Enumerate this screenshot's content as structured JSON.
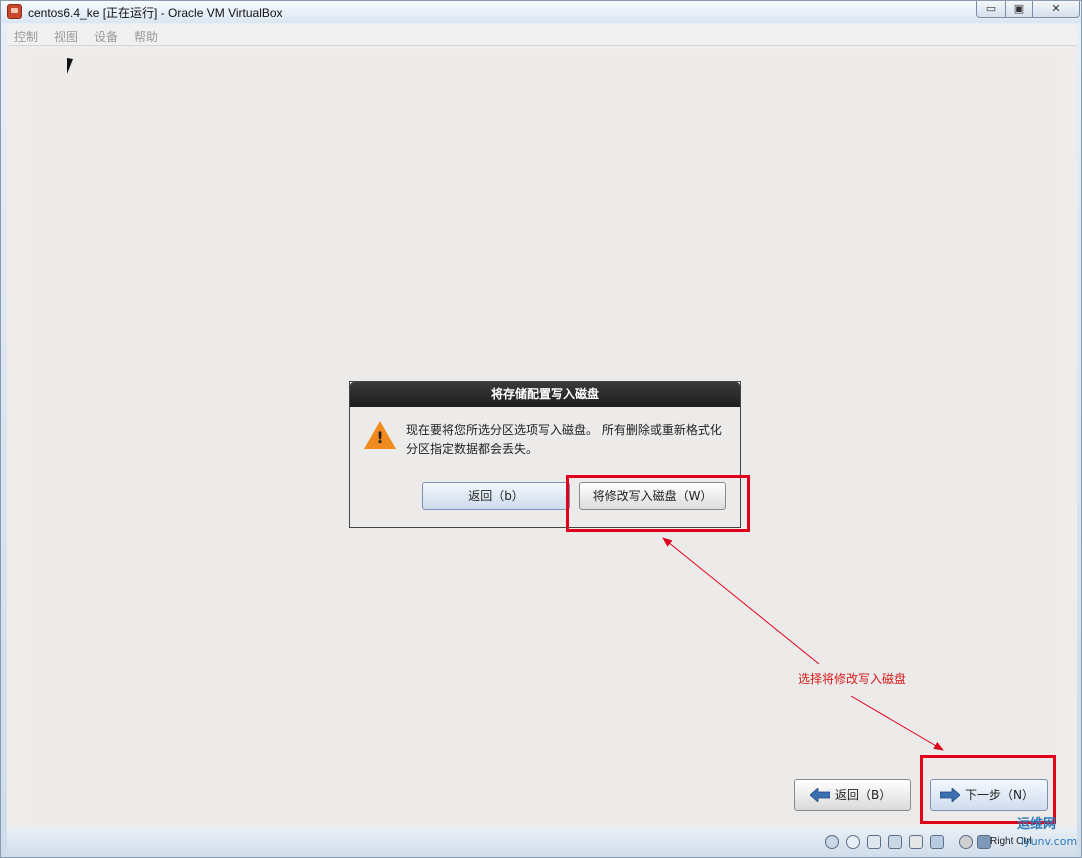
{
  "window": {
    "title": "centos6.4_ke [正在运行] - Oracle VM VirtualBox",
    "min_glyph": "▭",
    "max_glyph": "▣",
    "close_glyph": "✕"
  },
  "menu": {
    "items": [
      "控制",
      "视图",
      "设备",
      "帮助"
    ]
  },
  "dialog": {
    "title": "将存储配置写入磁盘",
    "message": "现在要将您所选分区选项写入磁盘。 所有删除或重新格式化分区指定数据都会丢失。",
    "back_label": "返回（b）",
    "write_label": "将修改写入磁盘（W）",
    "warning_mark": "!"
  },
  "annotation": {
    "text": "选择将修改写入磁盘",
    "color": "#e0001b"
  },
  "nav": {
    "back_label": "返回（B）",
    "next_label": "下一步（N）"
  },
  "statusbar": {
    "host_key": "Right Ctrl",
    "icons": [
      "hard-disk-icon",
      "cd-icon",
      "pen-icon",
      "network-icon",
      "folder-icon",
      "display-icon",
      "mouse-icon",
      "host-key-icon"
    ]
  },
  "watermark": {
    "text": "运维网",
    "sub": "iyunv.com"
  }
}
